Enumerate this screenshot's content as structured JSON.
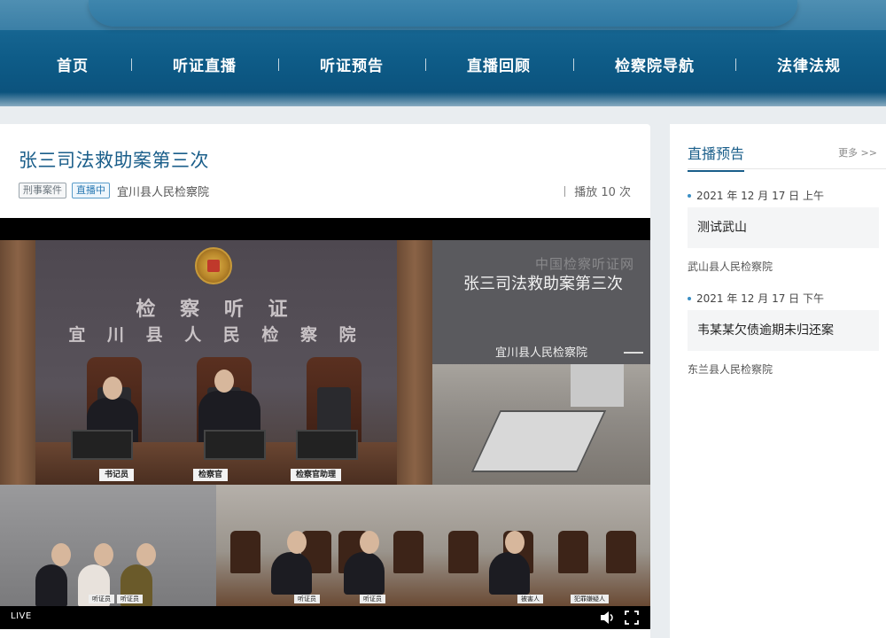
{
  "nav": {
    "items": [
      {
        "label": "首页"
      },
      {
        "label": "听证直播"
      },
      {
        "label": "听证预告"
      },
      {
        "label": "直播回顾"
      },
      {
        "label": "检察院导航"
      },
      {
        "label": "法律法规"
      }
    ]
  },
  "case": {
    "title": "张三司法救助案第三次",
    "tag_type": "刑事案件",
    "tag_status": "直播中",
    "org": "宜川县人民检察院",
    "plays_label": "播放 10 次"
  },
  "video": {
    "wall_title": "检 察 听 证",
    "wall_subtitle": "宜 川 县 人 民 检 察 院",
    "plates": [
      "书记员",
      "检察官",
      "检察官助理"
    ],
    "small_plates": [
      "听证员",
      "听证员",
      "听证员",
      "听证员",
      "被害人",
      "犯罪嫌疑人"
    ],
    "watermark": "中国检察听证网",
    "panel_title": "张三司法救助案第三次",
    "panel_org": "宜川县人民检察院",
    "live_label": "LIVE"
  },
  "sidebar": {
    "title": "直播预告",
    "more_label": "更多 >>",
    "items": [
      {
        "date": "2021 年 12 月 17 日 上午",
        "title": "测试武山",
        "org": "武山县人民检察院"
      },
      {
        "date": "2021 年 12 月 17 日 下午",
        "title": "韦某某欠债逾期未归还案",
        "org": "东兰县人民检察院"
      }
    ]
  },
  "colors": {
    "header": "#0e5c88",
    "accent": "#1a5e8a",
    "live_tag": "#2b7ab3"
  }
}
